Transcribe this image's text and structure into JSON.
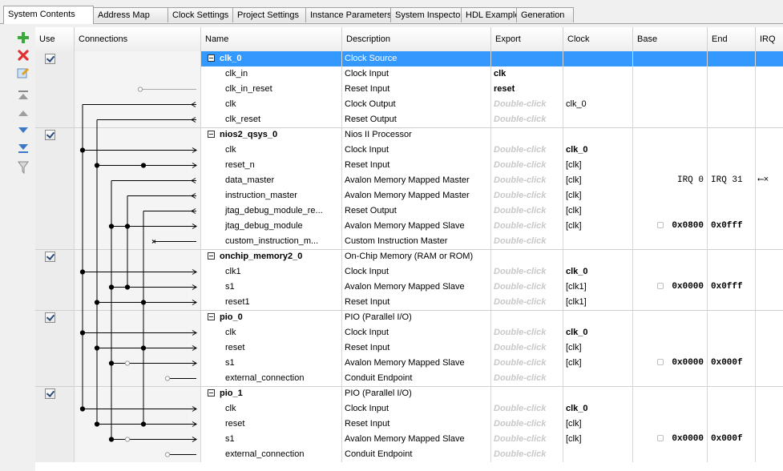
{
  "tabs": [
    {
      "label": "System Contents",
      "active": true
    },
    {
      "label": "Address Map"
    },
    {
      "label": "Clock Settings"
    },
    {
      "label": "Project Settings"
    },
    {
      "label": "Instance Parameters"
    },
    {
      "label": "System Inspector"
    },
    {
      "label": "HDL Example"
    },
    {
      "label": "Generation"
    }
  ],
  "toolbar": [
    "add-icon",
    "remove-icon",
    "edit-icon",
    "move-top-icon",
    "move-up-icon",
    "move-down-icon",
    "move-bottom-icon",
    "filter-icon"
  ],
  "columns": {
    "use": "Use",
    "connections": "Connections",
    "name": "Name",
    "description": "Description",
    "export": "Export",
    "clock": "Clock",
    "base": "Base",
    "end": "End",
    "irq": "IRQ"
  },
  "rows": [
    {
      "kind": "group",
      "use": true,
      "name": "clk_0",
      "desc": "Clock Source",
      "selected": true
    },
    {
      "kind": "iface",
      "name": "clk_in",
      "desc": "Clock Input",
      "export": "clk"
    },
    {
      "kind": "iface",
      "name": "clk_in_reset",
      "desc": "Reset Input",
      "export": "reset"
    },
    {
      "kind": "iface",
      "name": "clk",
      "desc": "Clock Output",
      "export": "Double-click",
      "export_hint": true,
      "clock": "clk_0"
    },
    {
      "kind": "iface",
      "name": "clk_reset",
      "desc": "Reset Output",
      "export": "Double-click",
      "export_hint": true
    },
    {
      "kind": "group",
      "use": true,
      "name": "nios2_qsys_0",
      "desc": "Nios II Processor"
    },
    {
      "kind": "iface",
      "name": "clk",
      "desc": "Clock Input",
      "export": "Double-click",
      "export_hint": true,
      "clock": "clk_0",
      "clock_bold": true
    },
    {
      "kind": "iface",
      "name": "reset_n",
      "desc": "Reset Input",
      "export": "Double-click",
      "export_hint": true,
      "clock": "[clk]"
    },
    {
      "kind": "iface",
      "name": "data_master",
      "desc": "Avalon Memory Mapped Master",
      "export": "Double-click",
      "export_hint": true,
      "clock": "[clk]",
      "base": "IRQ 0",
      "end": "IRQ 31",
      "irq": "⟵×"
    },
    {
      "kind": "iface",
      "name": "instruction_master",
      "desc": "Avalon Memory Mapped Master",
      "export": "Double-click",
      "export_hint": true,
      "clock": "[clk]"
    },
    {
      "kind": "iface",
      "name": "jtag_debug_module_re...",
      "desc": "Reset Output",
      "export": "Double-click",
      "export_hint": true,
      "clock": "[clk]"
    },
    {
      "kind": "iface",
      "name": "jtag_debug_module",
      "desc": "Avalon Memory Mapped Slave",
      "export": "Double-click",
      "export_hint": true,
      "clock": "[clk]",
      "base": "0x0800",
      "end": "0x0fff",
      "lock": true
    },
    {
      "kind": "iface",
      "name": "custom_instruction_m...",
      "desc": "Custom Instruction Master",
      "export": "Double-click",
      "export_hint": true
    },
    {
      "kind": "group",
      "use": true,
      "name": "onchip_memory2_0",
      "desc": "On-Chip Memory (RAM or ROM)"
    },
    {
      "kind": "iface",
      "name": "clk1",
      "desc": "Clock Input",
      "export": "Double-click",
      "export_hint": true,
      "clock": "clk_0",
      "clock_bold": true
    },
    {
      "kind": "iface",
      "name": "s1",
      "desc": "Avalon Memory Mapped Slave",
      "export": "Double-click",
      "export_hint": true,
      "clock": "[clk1]",
      "base": "0x0000",
      "end": "0x0fff",
      "lock": true
    },
    {
      "kind": "iface",
      "name": "reset1",
      "desc": "Reset Input",
      "export": "Double-click",
      "export_hint": true,
      "clock": "[clk1]"
    },
    {
      "kind": "group",
      "use": true,
      "name": "pio_0",
      "desc": "PIO (Parallel I/O)"
    },
    {
      "kind": "iface",
      "name": "clk",
      "desc": "Clock Input",
      "export": "Double-click",
      "export_hint": true,
      "clock": "clk_0",
      "clock_bold": true
    },
    {
      "kind": "iface",
      "name": "reset",
      "desc": "Reset Input",
      "export": "Double-click",
      "export_hint": true,
      "clock": "[clk]"
    },
    {
      "kind": "iface",
      "name": "s1",
      "desc": "Avalon Memory Mapped Slave",
      "export": "Double-click",
      "export_hint": true,
      "clock": "[clk]",
      "base": "0x0000",
      "end": "0x000f",
      "lock": true
    },
    {
      "kind": "iface",
      "name": "external_connection",
      "desc": "Conduit Endpoint",
      "export": "Double-click",
      "export_hint": true
    },
    {
      "kind": "group",
      "use": true,
      "name": "pio_1",
      "desc": "PIO (Parallel I/O)"
    },
    {
      "kind": "iface",
      "name": "clk",
      "desc": "Clock Input",
      "export": "Double-click",
      "export_hint": true,
      "clock": "clk_0",
      "clock_bold": true
    },
    {
      "kind": "iface",
      "name": "reset",
      "desc": "Reset Input",
      "export": "Double-click",
      "export_hint": true,
      "clock": "[clk]"
    },
    {
      "kind": "iface",
      "name": "s1",
      "desc": "Avalon Memory Mapped Slave",
      "export": "Double-click",
      "export_hint": true,
      "clock": "[clk]",
      "base": "0x0000",
      "end": "0x000f",
      "lock": true
    },
    {
      "kind": "iface",
      "name": "external_connection",
      "desc": "Conduit Endpoint",
      "export": "Double-click",
      "export_hint": true
    }
  ]
}
